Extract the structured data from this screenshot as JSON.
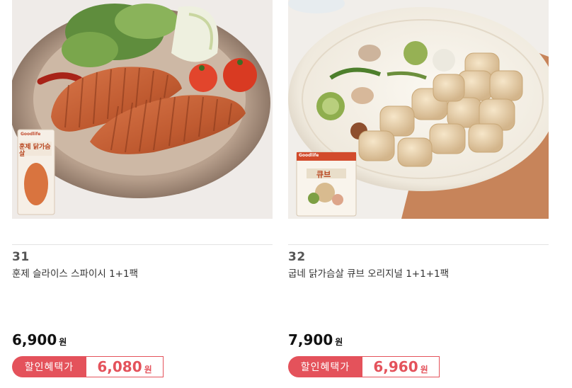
{
  "products": [
    {
      "rank": "31",
      "name": "훈제 슬라이스 스파이시 1+1팩",
      "price": "6,900",
      "currency": "원",
      "promo_label": "할인혜택가",
      "promo_price": "6,080",
      "package_text": "훈제 닭가슴살",
      "brand": "Goodlife"
    },
    {
      "rank": "32",
      "name": "굽네 닭가슴살 큐브 오리지널 1+1+1팩",
      "price": "7,900",
      "currency": "원",
      "promo_label": "할인혜택가",
      "promo_price": "6,960",
      "package_text": "큐브",
      "brand": "Goodlife"
    }
  ],
  "colors": {
    "accent": "#e4525b",
    "text": "#222222",
    "divider": "#e3e3e3"
  }
}
